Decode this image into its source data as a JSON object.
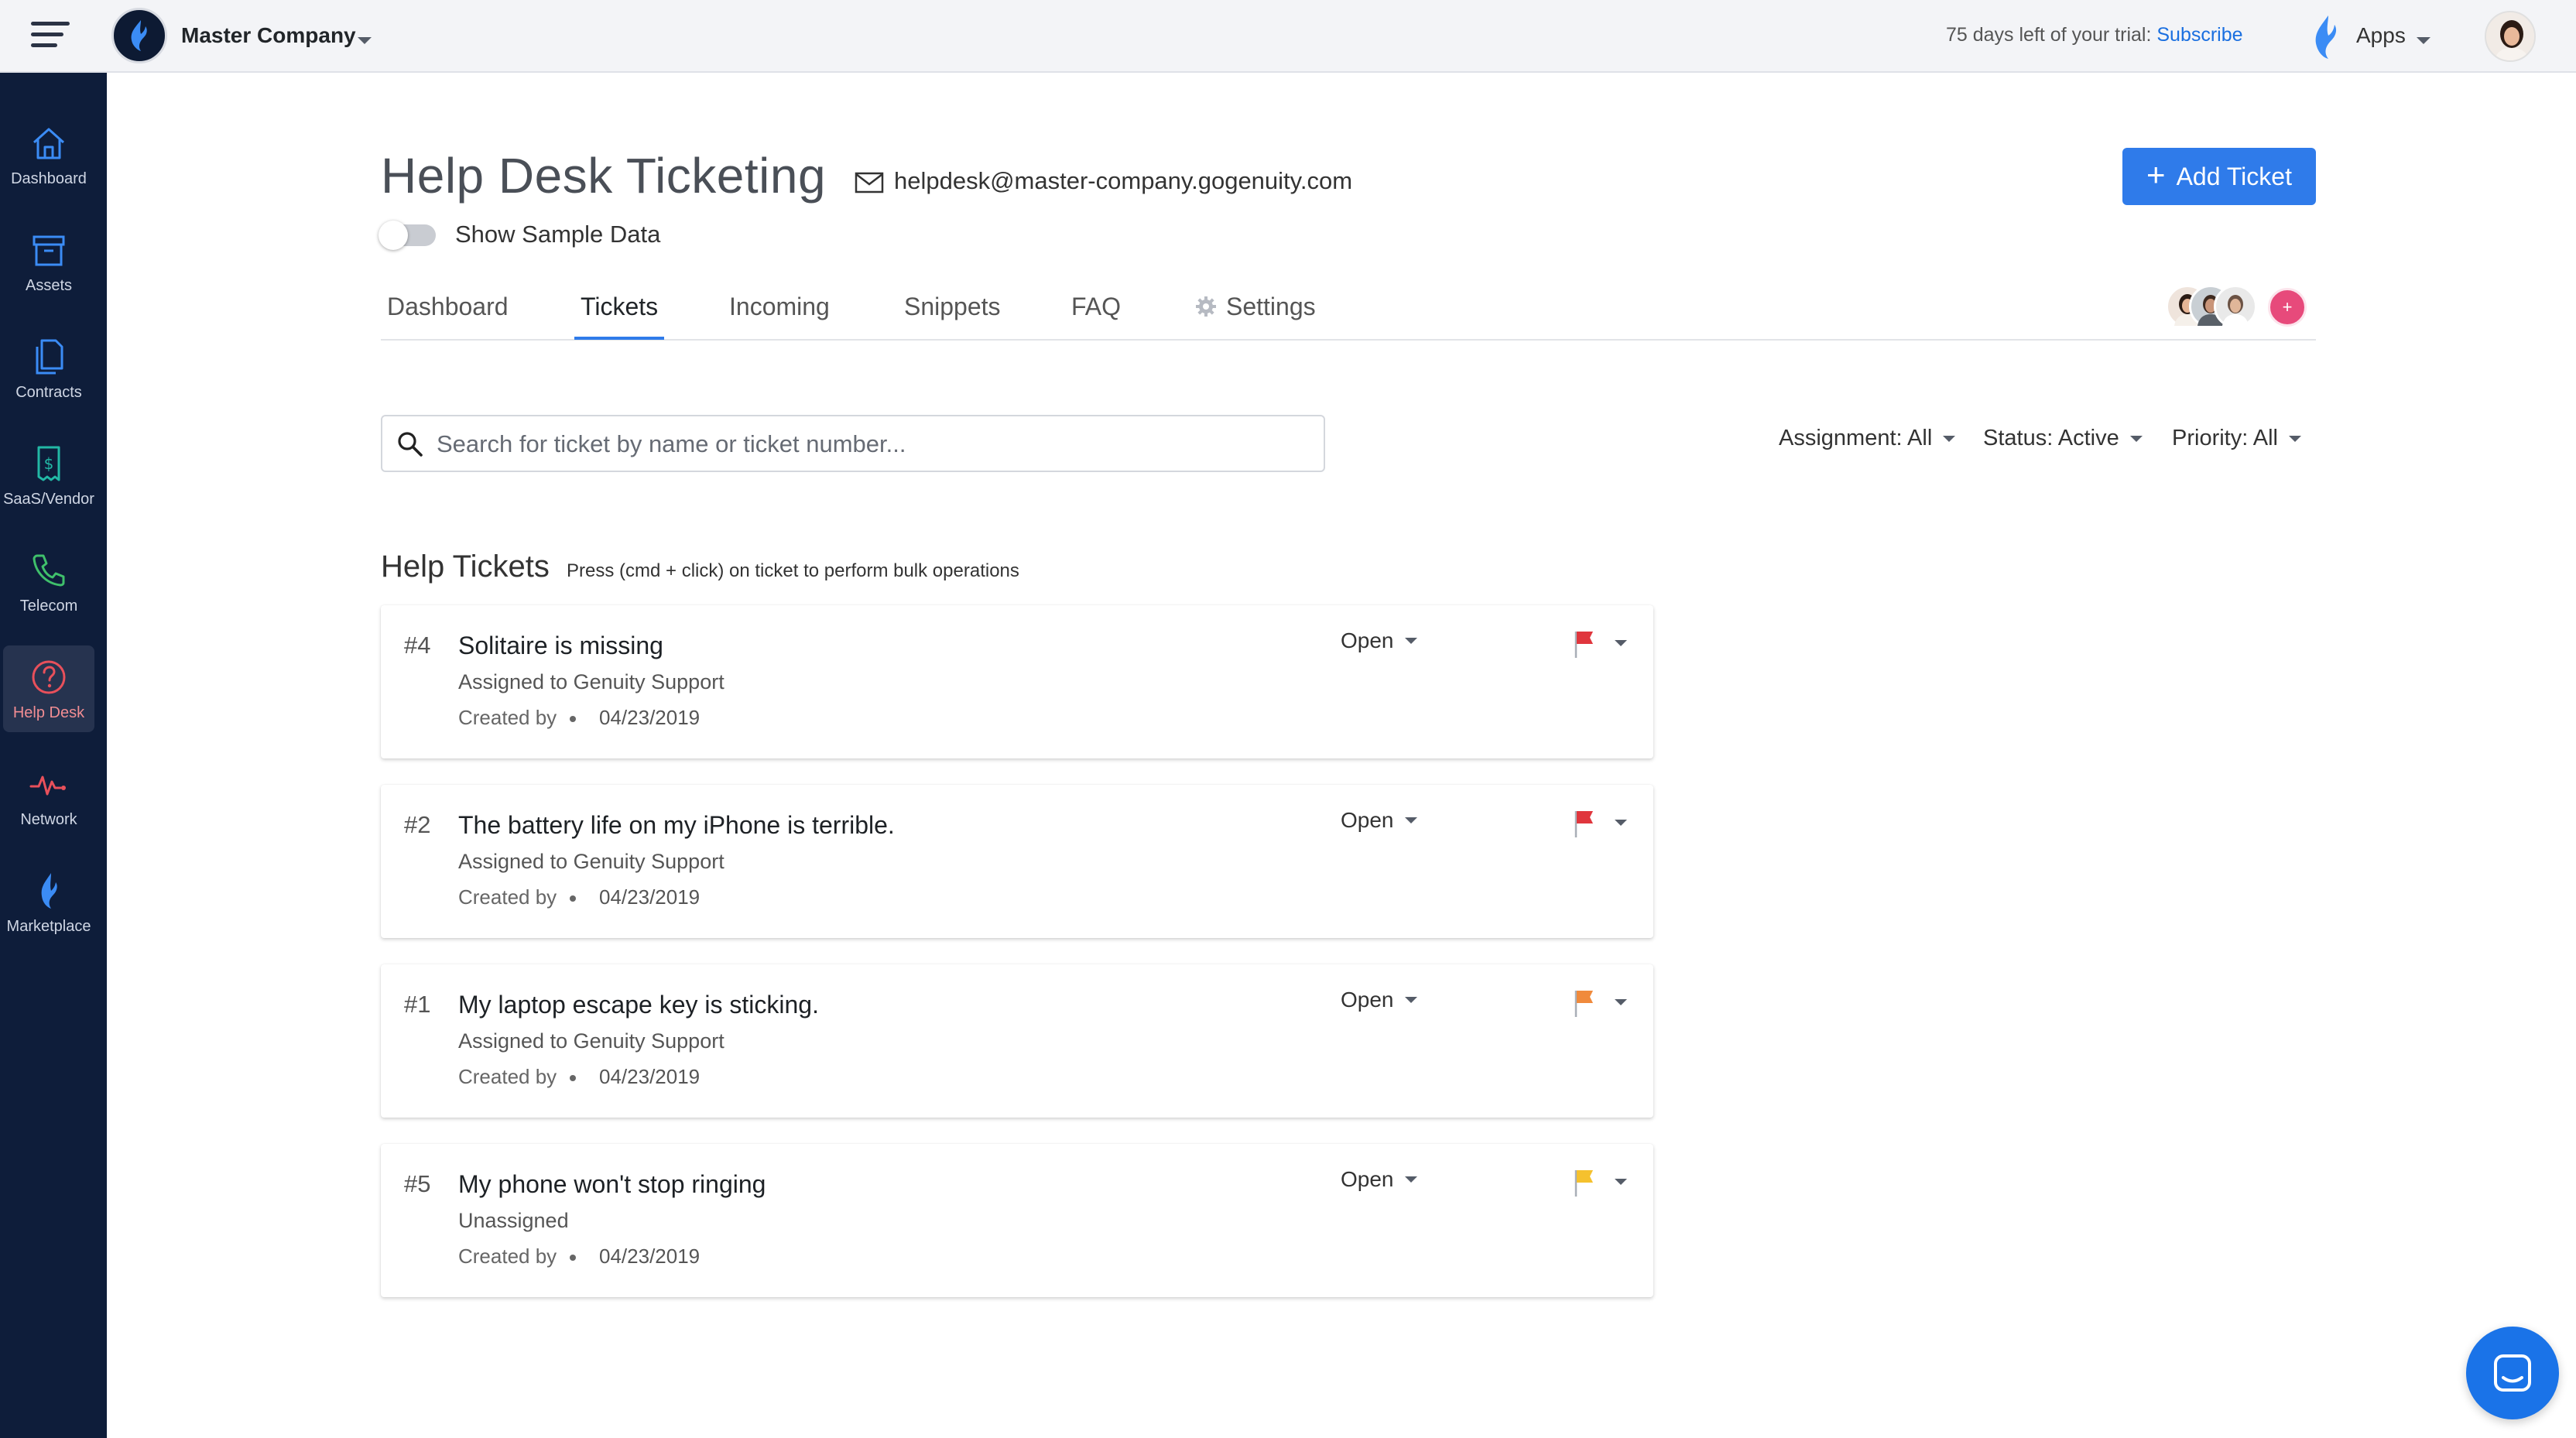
{
  "topbar": {
    "company_name": "Master Company",
    "trial_text": "75 days left of your trial:",
    "trial_link": "Subscribe",
    "apps_label": "Apps"
  },
  "sidebar": {
    "items": [
      {
        "label": "Dashboard",
        "icon": "home-icon"
      },
      {
        "label": "Assets",
        "icon": "archive-box-icon"
      },
      {
        "label": "Contracts",
        "icon": "documents-icon"
      },
      {
        "label": "SaaS/Vendor",
        "icon": "receipt-dollar-icon"
      },
      {
        "label": "Telecom",
        "icon": "phone-icon"
      },
      {
        "label": "Help Desk",
        "icon": "question-circle-icon"
      },
      {
        "label": "Network",
        "icon": "pulse-icon"
      },
      {
        "label": "Marketplace",
        "icon": "flame-icon"
      }
    ],
    "active": "Help Desk"
  },
  "header": {
    "title": "Help Desk Ticketing",
    "email": "helpdesk@master-company.gogenuity.com",
    "add_ticket_label": "Add Ticket",
    "sample_data_label": "Show Sample Data"
  },
  "tabs": [
    {
      "label": "Dashboard"
    },
    {
      "label": "Tickets"
    },
    {
      "label": "Incoming"
    },
    {
      "label": "Snippets"
    },
    {
      "label": "FAQ"
    },
    {
      "label": "Settings"
    }
  ],
  "active_tab": "Tickets",
  "team": {
    "add_label": "+"
  },
  "search": {
    "placeholder": "Search for ticket by name or ticket number..."
  },
  "filters": [
    {
      "label": "Assignment: All"
    },
    {
      "label": "Status: Active"
    },
    {
      "label": "Priority: All"
    }
  ],
  "list": {
    "title": "Help Tickets",
    "hint": "Press (cmd + click) on ticket to perform bulk operations"
  },
  "tickets": [
    {
      "number": "#4",
      "title": "Solitaire is missing",
      "assignment": "Assigned to Genuity Support",
      "created_label": "Created by",
      "date": "04/23/2019",
      "status": "Open",
      "priority_color": "#e0363d"
    },
    {
      "number": "#2",
      "title": "The battery life on my iPhone is terrible.",
      "assignment": "Assigned to Genuity Support",
      "created_label": "Created by",
      "date": "04/23/2019",
      "status": "Open",
      "priority_color": "#e0363d"
    },
    {
      "number": "#1",
      "title": "My laptop escape key is sticking.",
      "assignment": "Assigned to Genuity Support",
      "created_label": "Created by",
      "date": "04/23/2019",
      "status": "Open",
      "priority_color": "#f08a3c"
    },
    {
      "number": "#5",
      "title": "My phone won't stop ringing",
      "assignment": "Unassigned",
      "created_label": "Created by",
      "date": "04/23/2019",
      "status": "Open",
      "priority_color": "#f5c12e"
    }
  ],
  "colors": {
    "accent": "#2f7bea",
    "sidebar_bg": "#0e1d3a",
    "active_nav": "#f18d93"
  }
}
